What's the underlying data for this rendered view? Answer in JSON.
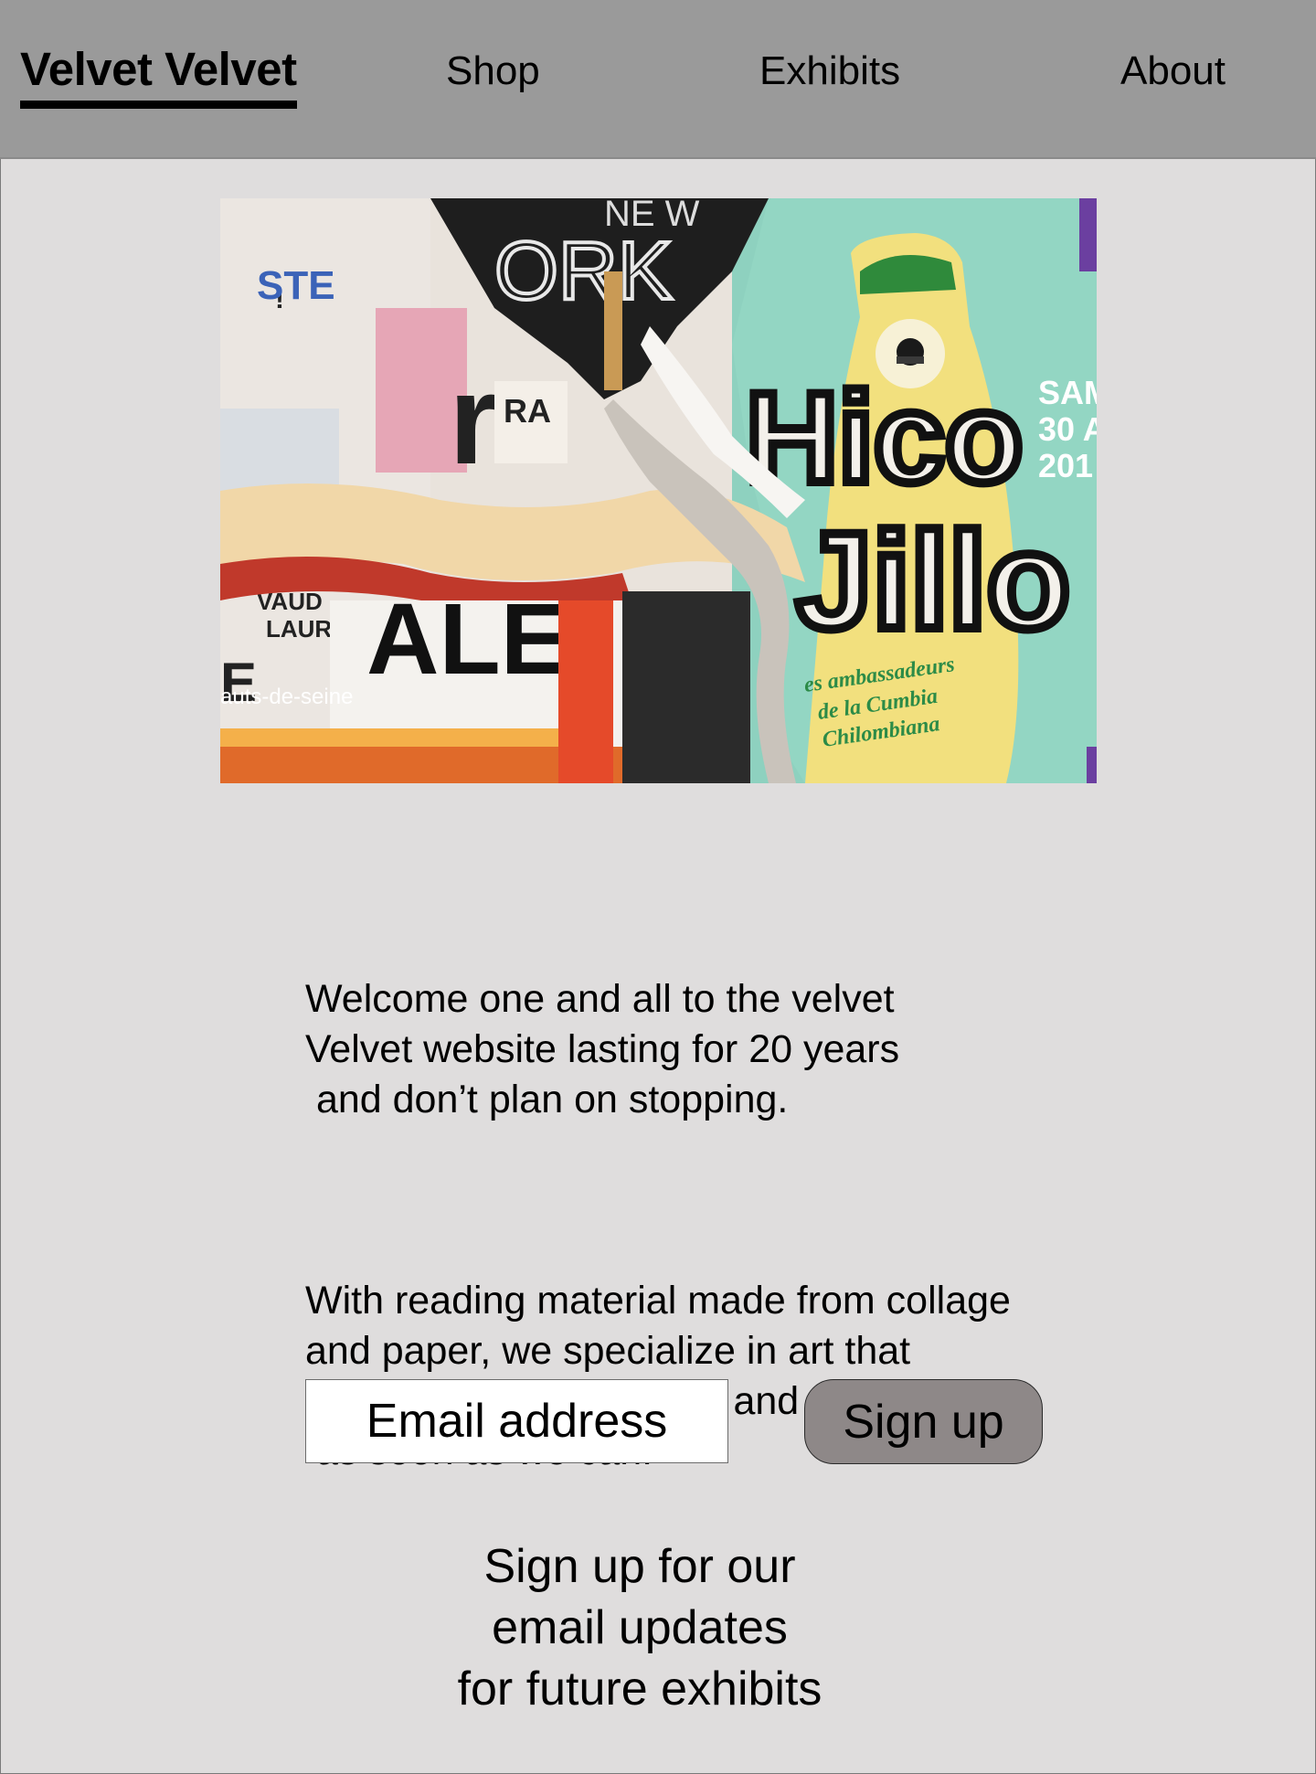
{
  "nav": {
    "brand": "Velvet Velvet",
    "links": [
      {
        "label": "Shop"
      },
      {
        "label": "Exhibits"
      },
      {
        "label": "About"
      }
    ]
  },
  "hero": {
    "image_subject": "torn layered street posters collage",
    "poster_text": [
      "NEW YORK",
      "Hico",
      "Jillo",
      "es ambassadeurs",
      "de la Cumbia",
      "Chilombiana",
      "SAM",
      "30 A",
      "201",
      "auts-de-seine",
      "ALE"
    ]
  },
  "intro": {
    "paragraph1": "Welcome one and all to the velvet\nVelvet website lasting for 20 years\n and don’t plan on stopping.",
    "paragraph2": "With reading material made from collage\nand paper, we specialize in art that\nspeaks to the consumer and deliver\n as soon as we can."
  },
  "signup": {
    "email_placeholder": "Email address",
    "button_label": "Sign up",
    "note": "Sign up for our\nemail updates\nfor future exhibits"
  },
  "colors": {
    "page_background": "#dfdddd",
    "nav_background": "#9a9a9a",
    "button_background": "#8e8888"
  }
}
